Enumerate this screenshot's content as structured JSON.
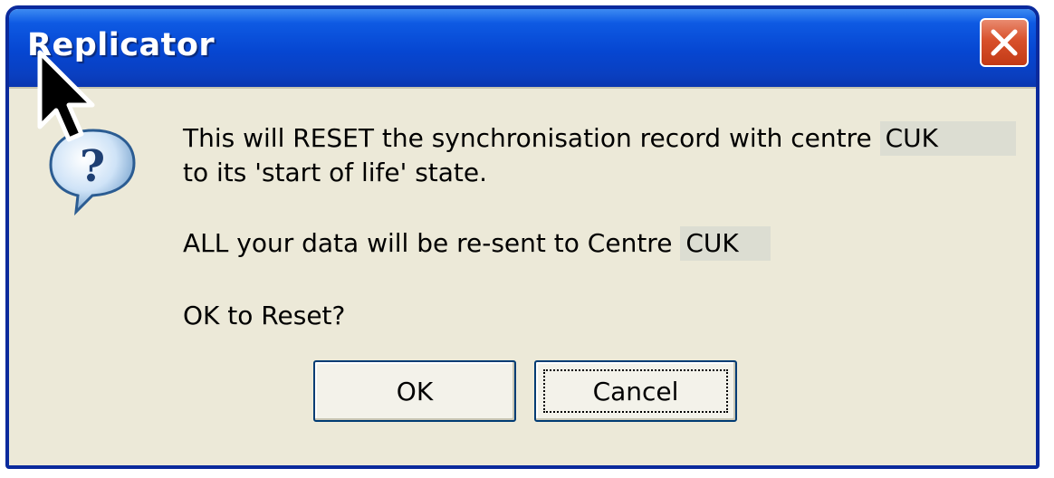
{
  "dialog": {
    "title": "Replicator",
    "message_line1": "This will RESET the synchronisation record with centre",
    "centre_code_1": "CUK",
    "message_line2": "to its 'start of life' state.",
    "message_line3": "ALL your data will be re-sent to Centre",
    "centre_code_2": "CUK",
    "question": "OK to Reset?",
    "ok_label": "OK",
    "cancel_label": "Cancel",
    "icon": "question-icon",
    "focused_button": "Cancel"
  },
  "colors": {
    "titlebar": "#0646d1",
    "body": "#ece9d8",
    "close_button": "#d8502b"
  }
}
